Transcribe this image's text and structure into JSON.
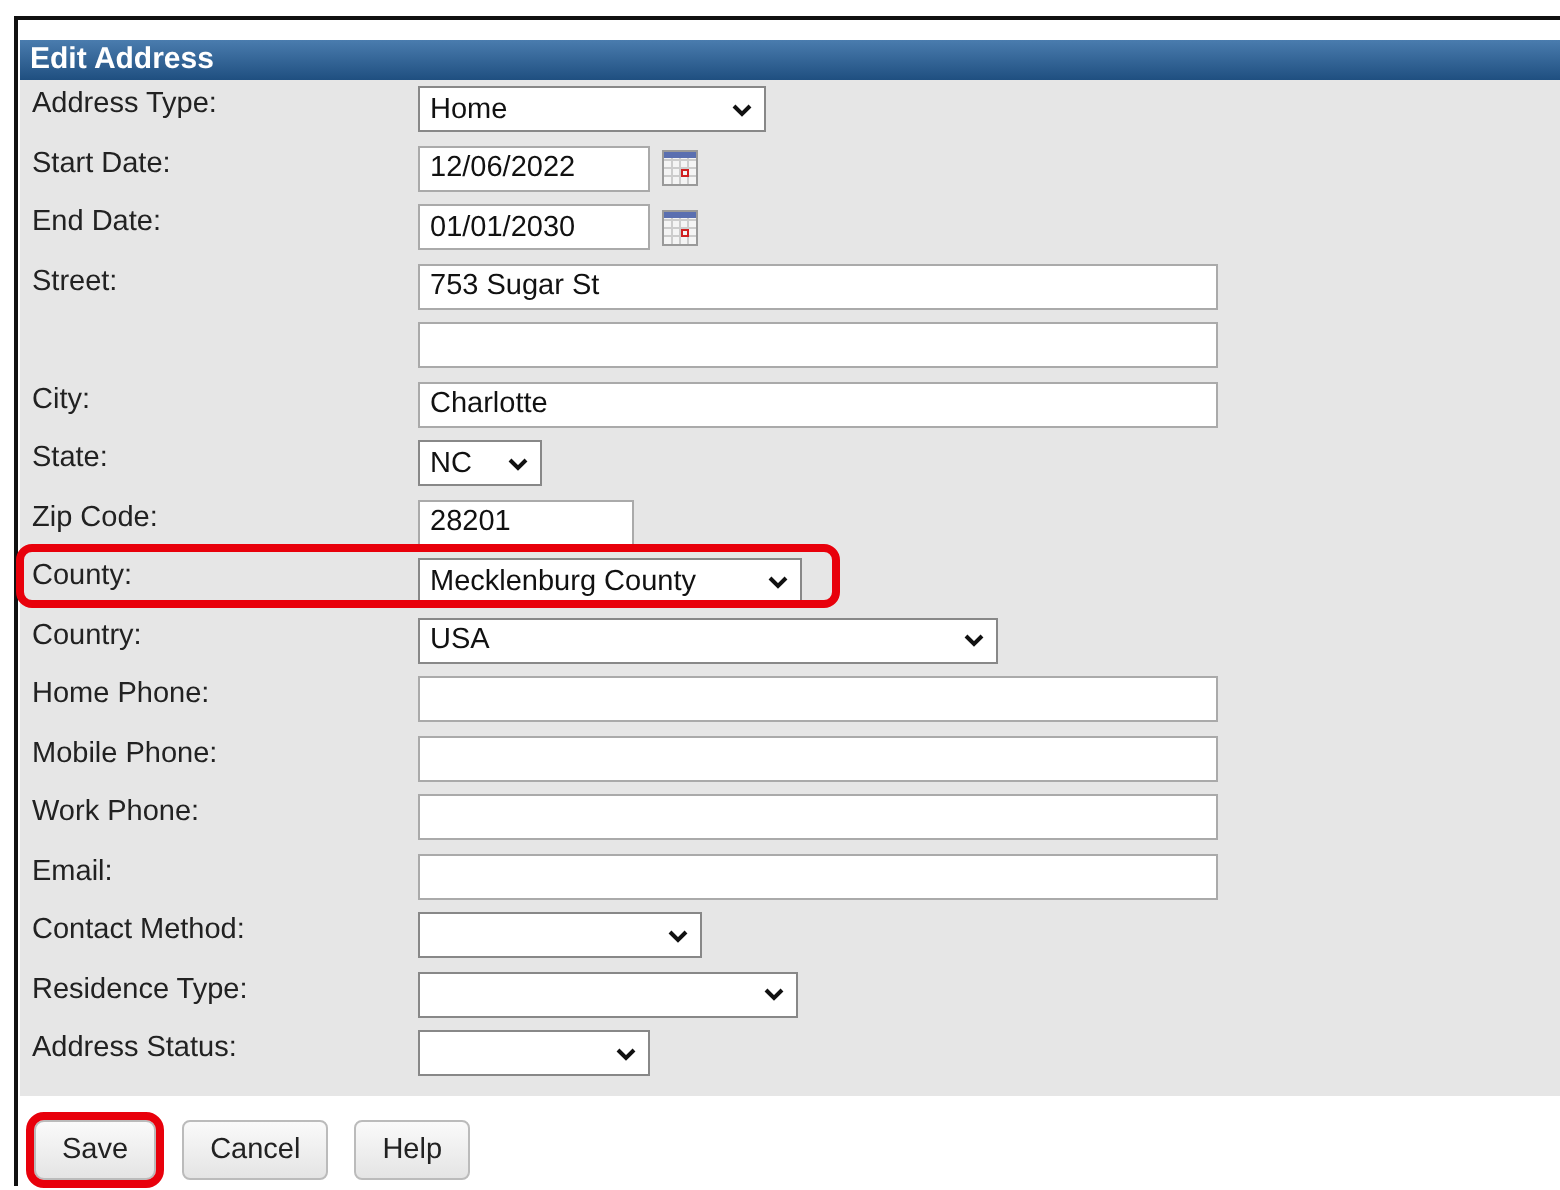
{
  "panel": {
    "title": "Edit Address"
  },
  "rows": [
    {
      "label": "Address Type:",
      "kind": "select",
      "value": "Home",
      "highlighted": false
    },
    {
      "label": "Start Date:",
      "kind": "date",
      "value": "12/06/2022",
      "highlighted": false
    },
    {
      "label": "End Date:",
      "kind": "date",
      "value": "01/01/2030",
      "highlighted": false
    },
    {
      "label": "Street:",
      "kind": "text",
      "value": "753 Sugar St",
      "highlighted": false
    },
    {
      "kind": "text",
      "highlighted": false
    },
    {
      "label": "City:",
      "kind": "text",
      "value": "Charlotte",
      "highlighted": false
    },
    {
      "label": "State:",
      "kind": "select",
      "value": "NC",
      "highlighted": false
    },
    {
      "label": "Zip Code:",
      "kind": "text",
      "value": "28201",
      "highlighted": false
    },
    {
      "label": "County:",
      "kind": "select",
      "value": "Mecklenburg County",
      "highlighted": true
    },
    {
      "label": "Country:",
      "kind": "select",
      "value": "USA",
      "highlighted": false
    },
    {
      "label": "Home Phone:",
      "kind": "text",
      "highlighted": false
    },
    {
      "label": "Mobile Phone:",
      "kind": "text",
      "highlighted": false
    },
    {
      "label": "Work Phone:",
      "kind": "text",
      "highlighted": false
    },
    {
      "label": "Email:",
      "kind": "text",
      "highlighted": false
    },
    {
      "label": "Contact Method:",
      "kind": "select",
      "highlighted": false
    },
    {
      "label": "Residence Type:",
      "kind": "select",
      "highlighted": false
    },
    {
      "label": "Address Status:",
      "kind": "select",
      "highlighted": false
    }
  ],
  "buttons": [
    {
      "label": "Save",
      "highlighted": true
    },
    {
      "label": "Cancel",
      "highlighted": false
    },
    {
      "label": "Help",
      "highlighted": false
    }
  ]
}
